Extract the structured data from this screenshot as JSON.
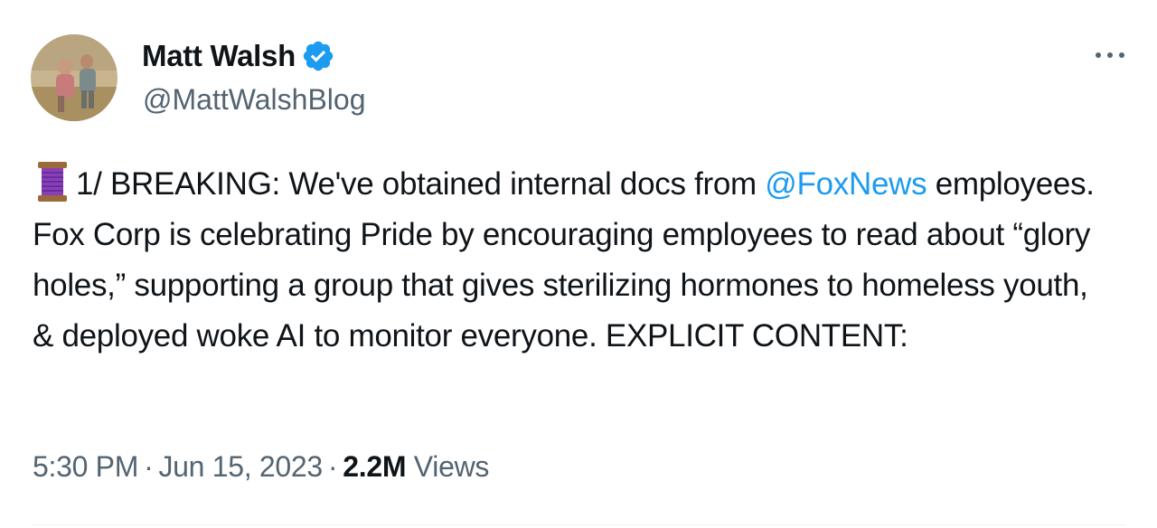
{
  "author": {
    "display_name": "Matt Walsh",
    "handle": "@MattWalshBlog",
    "verified": true,
    "avatar_icon": "avatar-photo"
  },
  "more_icon": "more-dots-icon",
  "tweet": {
    "emoji_icon": "thread-spool-icon",
    "text_before_mention": "1/ BREAKING: We've obtained internal docs from ",
    "mention": "@FoxNews",
    "text_after_mention": " employees. Fox Corp is celebrating Pride by encouraging employees to read about “glory holes,” supporting a group that gives sterilizing hormones to homeless youth, & deployed woke AI to monitor everyone. EXPLICIT CONTENT:"
  },
  "meta": {
    "time": "5:30 PM",
    "separator": "·",
    "date": "Jun 15, 2023",
    "views_count": "2.2M",
    "views_label": "Views"
  },
  "colors": {
    "link": "#1d9bf0",
    "secondary_text": "#536471",
    "primary_text": "#0f1419",
    "verified_badge": "#1d9bf0"
  }
}
